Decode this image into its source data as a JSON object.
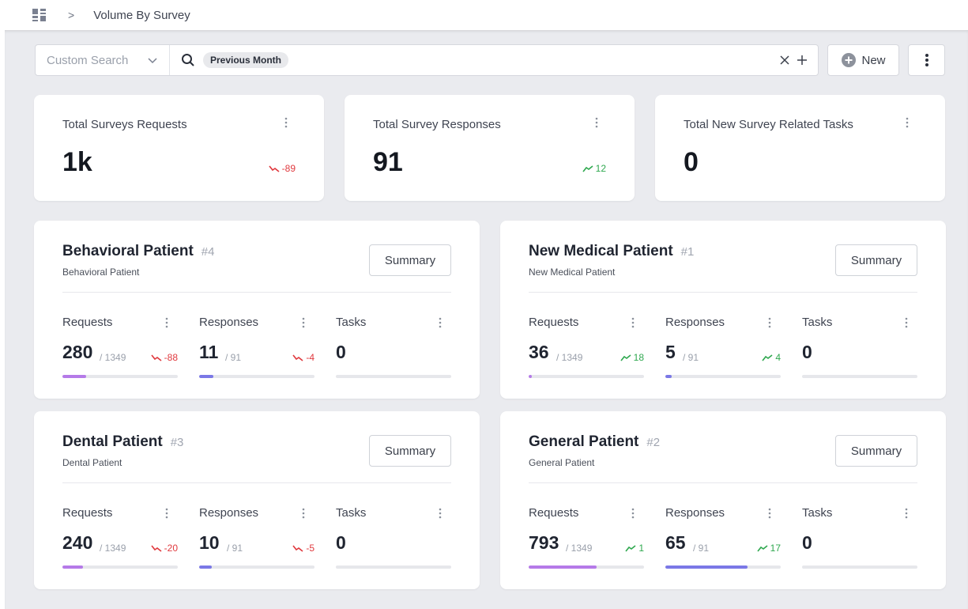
{
  "breadcrumb": {
    "page": "Volume By Survey"
  },
  "search": {
    "custom_search_label": "Custom Search",
    "chip": "Previous Month"
  },
  "toolbar": {
    "new_label": "New"
  },
  "stats": [
    {
      "title": "Total Surveys Requests",
      "value": "1k",
      "trend": "-89",
      "direction": "down"
    },
    {
      "title": "Total Survey Responses",
      "value": "91",
      "trend": "12",
      "direction": "up"
    },
    {
      "title": "Total New Survey Related Tasks",
      "value": "0",
      "trend": "",
      "direction": ""
    }
  ],
  "patients": [
    {
      "name": "Behavioral Patient",
      "number": "#4",
      "subtitle": "Behavioral Patient",
      "summary_label": "Summary",
      "requests": {
        "label": "Requests",
        "value": "280",
        "total": "/ 1349",
        "trend": "-88",
        "direction": "down",
        "fraction": 0.208
      },
      "responses": {
        "label": "Responses",
        "value": "11",
        "total": "/ 91",
        "trend": "-4",
        "direction": "down",
        "fraction": 0.121
      },
      "tasks": {
        "label": "Tasks",
        "value": "0",
        "fraction": 0
      }
    },
    {
      "name": "New Medical Patient",
      "number": "#1",
      "subtitle": "New Medical Patient",
      "summary_label": "Summary",
      "requests": {
        "label": "Requests",
        "value": "36",
        "total": "/ 1349",
        "trend": "18",
        "direction": "up",
        "fraction": 0.027
      },
      "responses": {
        "label": "Responses",
        "value": "5",
        "total": "/ 91",
        "trend": "4",
        "direction": "up",
        "fraction": 0.055
      },
      "tasks": {
        "label": "Tasks",
        "value": "0",
        "fraction": 0
      }
    },
    {
      "name": "Dental Patient",
      "number": "#3",
      "subtitle": "Dental Patient",
      "summary_label": "Summary",
      "requests": {
        "label": "Requests",
        "value": "240",
        "total": "/ 1349",
        "trend": "-20",
        "direction": "down",
        "fraction": 0.178
      },
      "responses": {
        "label": "Responses",
        "value": "10",
        "total": "/ 91",
        "trend": "-5",
        "direction": "down",
        "fraction": 0.11
      },
      "tasks": {
        "label": "Tasks",
        "value": "0",
        "fraction": 0
      }
    },
    {
      "name": "General Patient",
      "number": "#2",
      "subtitle": "General Patient",
      "summary_label": "Summary",
      "requests": {
        "label": "Requests",
        "value": "793",
        "total": "/ 1349",
        "trend": "1",
        "direction": "up",
        "fraction": 0.588
      },
      "responses": {
        "label": "Responses",
        "value": "65",
        "total": "/ 91",
        "trend": "17",
        "direction": "up",
        "fraction": 0.714
      },
      "tasks": {
        "label": "Tasks",
        "value": "0",
        "fraction": 0
      }
    }
  ],
  "colors": {
    "trend_down": "#e0393e",
    "trend_up": "#2fa84f",
    "requests_bar": "#b57ae8",
    "responses_bar": "#7b78e6"
  }
}
